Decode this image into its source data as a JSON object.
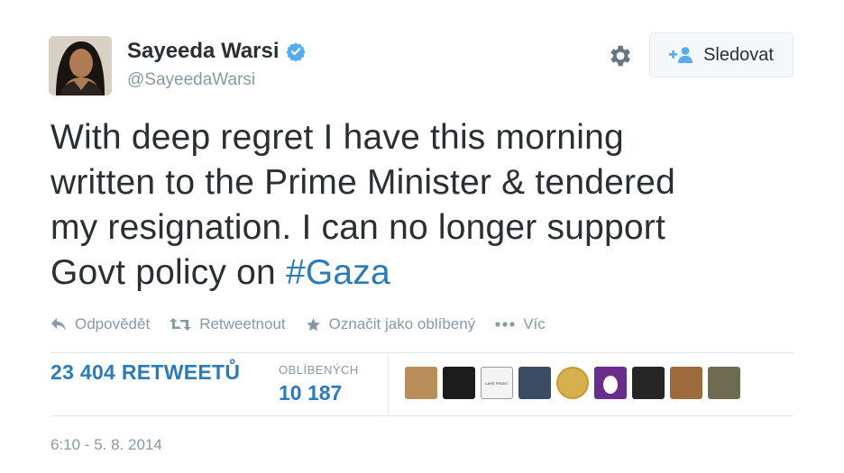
{
  "author": {
    "name": "Sayeeda Warsi",
    "handle": "@SayeedaWarsi",
    "verified": true
  },
  "header": {
    "follow_label": "Sledovat"
  },
  "tweet": {
    "text_lines": [
      "With deep regret I have this morning",
      "written to the Prime Minister &  tendered",
      "my resignation. I can no longer support",
      "Govt policy on "
    ],
    "hashtag": "#Gaza"
  },
  "actions": {
    "reply": "Odpovědět",
    "retweet": "Retweetnout",
    "favorite": "Označit jako oblíbený",
    "more": "Víc"
  },
  "stats": {
    "retweets": "23 404 RETWEETŮ",
    "favorites_label": "OBLÍBENÝCH",
    "favorites_value": "10 187"
  },
  "favoriters": [
    {
      "name": "favoriter-1",
      "color": "#b98d5a"
    },
    {
      "name": "favoriter-2",
      "color": "#1c1c1c"
    },
    {
      "name": "favoriter-3",
      "color": "#f3f3f3",
      "caption": "LAKE FRONT"
    },
    {
      "name": "favoriter-4",
      "color": "#3b4b63"
    },
    {
      "name": "favoriter-5",
      "color": "#d6b04e"
    },
    {
      "name": "favoriter-6",
      "color": "#6a2d8e"
    },
    {
      "name": "favoriter-7",
      "color": "#262626"
    },
    {
      "name": "favoriter-8",
      "color": "#9c6a3c"
    },
    {
      "name": "favoriter-9",
      "color": "#6f6b52"
    }
  ],
  "timestamp": "6:10 - 5. 8. 2014",
  "colors": {
    "link": "#2b7bb9",
    "muted": "#8899a6",
    "text": "#292f33"
  }
}
